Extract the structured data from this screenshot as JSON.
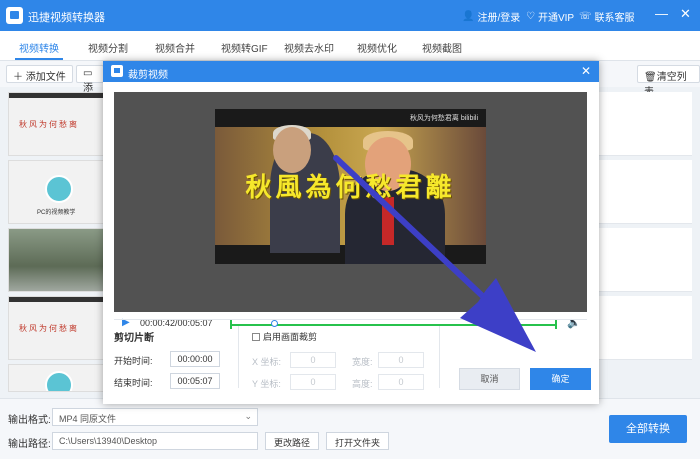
{
  "app": {
    "title": "迅捷视频转换器",
    "register_login": "注册/登录",
    "vip": "开通VIP",
    "support": "联系客服",
    "minimize": "—",
    "close": "✕"
  },
  "tabs": [
    "视频转换",
    "视频分割",
    "视频合并",
    "视频转GIF",
    "视频去水印",
    "视频优化",
    "视频截图"
  ],
  "toolbar": {
    "add_file": "添加文件",
    "add_folder": "添",
    "clear_list": "清空列表"
  },
  "thumbs": {
    "text_title": "秋风为何愁离",
    "avatar_label": "PC的视频教学"
  },
  "dialog": {
    "title": "裁剪视频",
    "close": "✕",
    "video": {
      "subtitle": "秋風為何愁君離",
      "watermark": "秋风为何愁君离 bilibili"
    },
    "player": {
      "time": "00:00:42/00:05:07",
      "progress_fraction": 0.137
    },
    "clip": {
      "section_title": "剪切片断",
      "start_label": "开始时间:",
      "start_value": "00:00:00",
      "end_label": "结束时间:",
      "end_value": "00:05:07",
      "crop_checkbox": "启用画面裁剪",
      "x_label": "X 坐标:",
      "x_value": "0",
      "y_label": "Y 坐标:",
      "y_value": "0",
      "width_label": "宽度:",
      "width_value": "0",
      "height_label": "高度:",
      "height_value": "0",
      "cancel": "取消",
      "confirm": "确定"
    }
  },
  "bottom": {
    "format_label": "输出格式:",
    "format_value": "MP4  同原文件",
    "path_label": "输出路径:",
    "path_value": "C:\\Users\\13940\\Desktop",
    "change_path": "更改路径",
    "open_folder": "打开文件夹",
    "convert_all": "全部转换"
  },
  "colors": {
    "accent": "#2f86e8",
    "track": "#27c24c",
    "annotation_arrow": "#3d3fc7"
  }
}
